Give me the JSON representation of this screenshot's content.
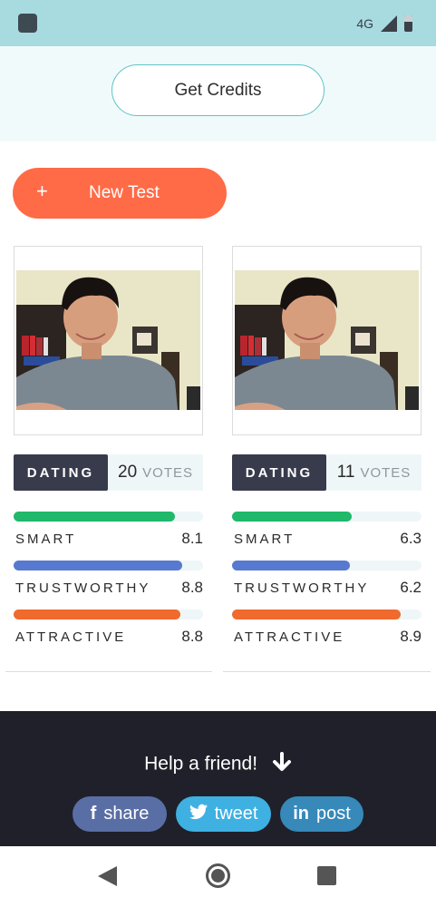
{
  "status_bar": {
    "network": "4G",
    "icons": [
      "app-icon",
      "signal-icon",
      "battery-icon"
    ]
  },
  "header": {
    "get_credits_label": "Get Credits"
  },
  "actions": {
    "new_test_plus": "+",
    "new_test_label": "New Test"
  },
  "tests": [
    {
      "category": "DATING",
      "votes_count": "20",
      "votes_label": "VOTES",
      "metrics": [
        {
          "label": "SMART",
          "score": "8.1",
          "fill": 0.85,
          "color": "#20b86a"
        },
        {
          "label": "TRUSTWORTHY",
          "score": "8.8",
          "fill": 0.89,
          "color": "#5879d0"
        },
        {
          "label": "ATTRACTIVE",
          "score": "8.8",
          "fill": 0.88,
          "color": "#f0692d"
        }
      ]
    },
    {
      "category": "DATING",
      "votes_count": "11",
      "votes_label": "VOTES",
      "metrics": [
        {
          "label": "SMART",
          "score": "6.3",
          "fill": 0.63,
          "color": "#20b86a"
        },
        {
          "label": "TRUSTWORTHY",
          "score": "6.2",
          "fill": 0.62,
          "color": "#5879d0"
        },
        {
          "label": "ATTRACTIVE",
          "score": "8.9",
          "fill": 0.89,
          "color": "#f0692d"
        }
      ]
    }
  ],
  "footer": {
    "help_text": "Help a friend!",
    "share_buttons": [
      {
        "icon": "f",
        "label": "share"
      },
      {
        "icon": "🐦",
        "label": "tweet"
      },
      {
        "icon": "in",
        "label": "post"
      }
    ]
  },
  "nav_bar": {
    "icons": [
      "back-icon",
      "home-icon",
      "recents-icon"
    ]
  }
}
